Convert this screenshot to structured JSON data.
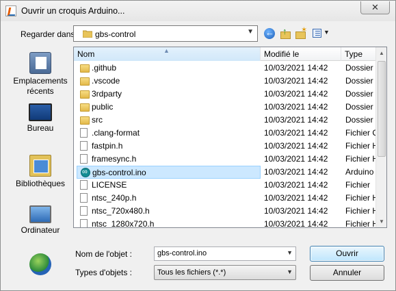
{
  "window": {
    "title": "Ouvrir un croquis Arduino...",
    "close_glyph": "✕"
  },
  "lookin": {
    "label": "Regarder dans :",
    "value": "gbs-control"
  },
  "toolbar": {
    "back_icon": "back-arrow-icon",
    "up_icon": "up-folder-icon",
    "new_icon": "new-folder-icon",
    "view_icon": "view-menu-icon"
  },
  "places": [
    {
      "label": "Emplacements récents",
      "icon": "recent-places-icon"
    },
    {
      "label": "Bureau",
      "icon": "desktop-icon"
    },
    {
      "label": "Bibliothèques",
      "icon": "libraries-icon"
    },
    {
      "label": "Ordinateur",
      "icon": "computer-icon"
    },
    {
      "label": "",
      "icon": "network-icon"
    }
  ],
  "columns": {
    "name": "Nom",
    "date": "Modifié le",
    "type": "Type"
  },
  "files": [
    {
      "name": ".github",
      "date": "10/03/2021 14:42",
      "type": "Dossier de fichiers",
      "kind": "folder"
    },
    {
      "name": ".vscode",
      "date": "10/03/2021 14:42",
      "type": "Dossier de fichiers",
      "kind": "folder"
    },
    {
      "name": "3rdparty",
      "date": "10/03/2021 14:42",
      "type": "Dossier de fichiers",
      "kind": "folder"
    },
    {
      "name": "public",
      "date": "10/03/2021 14:42",
      "type": "Dossier de fichiers",
      "kind": "folder"
    },
    {
      "name": "src",
      "date": "10/03/2021 14:42",
      "type": "Dossier de fichiers",
      "kind": "folder"
    },
    {
      "name": ".clang-format",
      "date": "10/03/2021 14:42",
      "type": "Fichier CLANG-FORMAT",
      "kind": "file"
    },
    {
      "name": "fastpin.h",
      "date": "10/03/2021 14:42",
      "type": "Fichier H",
      "kind": "file"
    },
    {
      "name": "framesync.h",
      "date": "10/03/2021 14:42",
      "type": "Fichier H",
      "kind": "file"
    },
    {
      "name": "gbs-control.ino",
      "date": "10/03/2021 14:42",
      "type": "Arduino file",
      "kind": "ino",
      "selected": true
    },
    {
      "name": "LICENSE",
      "date": "10/03/2021 14:42",
      "type": "Fichier",
      "kind": "file"
    },
    {
      "name": "ntsc_240p.h",
      "date": "10/03/2021 14:42",
      "type": "Fichier H",
      "kind": "file"
    },
    {
      "name": "ntsc_720x480.h",
      "date": "10/03/2021 14:42",
      "type": "Fichier H",
      "kind": "file"
    },
    {
      "name": "ntsc_1280x720.h",
      "date": "10/03/2021 14:42",
      "type": "Fichier H",
      "kind": "file"
    }
  ],
  "form": {
    "name_label": "Nom de l'objet :",
    "name_value": "gbs-control.ino",
    "type_label": "Types d'objets :",
    "type_value": "Tous les fichiers (*.*)",
    "open_label": "Ouvrir",
    "cancel_label": "Annuler"
  }
}
